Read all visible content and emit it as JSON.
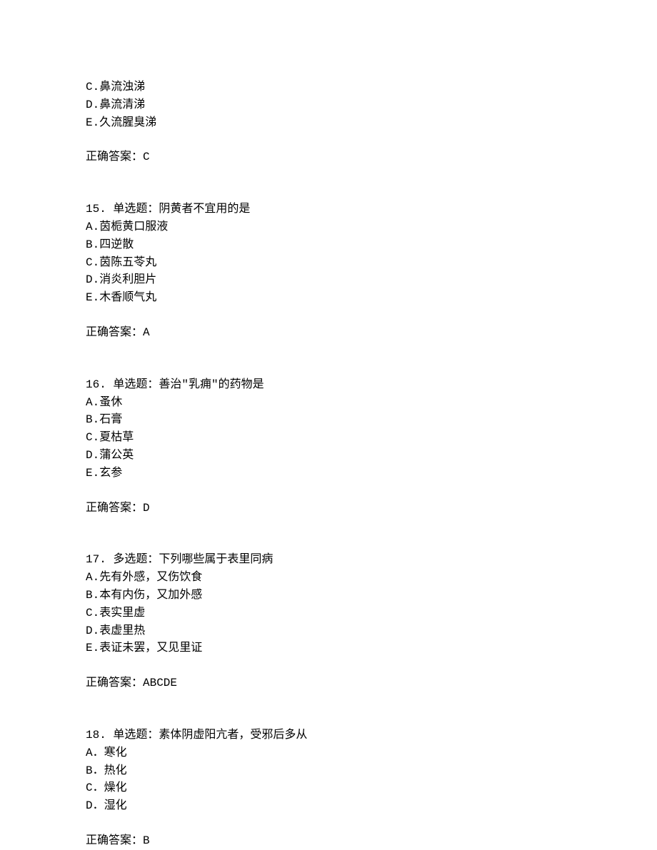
{
  "partial_q14": {
    "options": [
      "C.鼻流浊涕",
      "D.鼻流清涕",
      "E.久流腥臭涕"
    ],
    "answer": "正确答案：C"
  },
  "q15": {
    "header": "15. 单选题：阴黄者不宜用的是",
    "options": [
      "A.茵栀黄口服液",
      "B.四逆散",
      "C.茵陈五苓丸",
      "D.消炎利胆片",
      "E.木香顺气丸"
    ],
    "answer": "正确答案：A"
  },
  "q16": {
    "header": "16. 单选题：善治\"乳痈\"的药物是",
    "options": [
      "A.蚤休",
      "B.石膏",
      "C.夏枯草",
      "D.蒲公英",
      "E.玄参"
    ],
    "answer": "正确答案：D"
  },
  "q17": {
    "header": "17. 多选题：下列哪些属于表里同病",
    "options": [
      "A.先有外感，又伤饮食",
      "B.本有内伤，又加外感",
      "C.表实里虚",
      "D.表虚里热",
      "E.表证未罢，又见里证"
    ],
    "answer": "正确答案：ABCDE"
  },
  "q18": {
    "header": "18. 单选题：素体阴虚阳亢者，受邪后多从",
    "options": [
      "A．寒化",
      "B．热化",
      "C．燥化",
      "D．湿化"
    ],
    "answer": "正确答案：B"
  }
}
